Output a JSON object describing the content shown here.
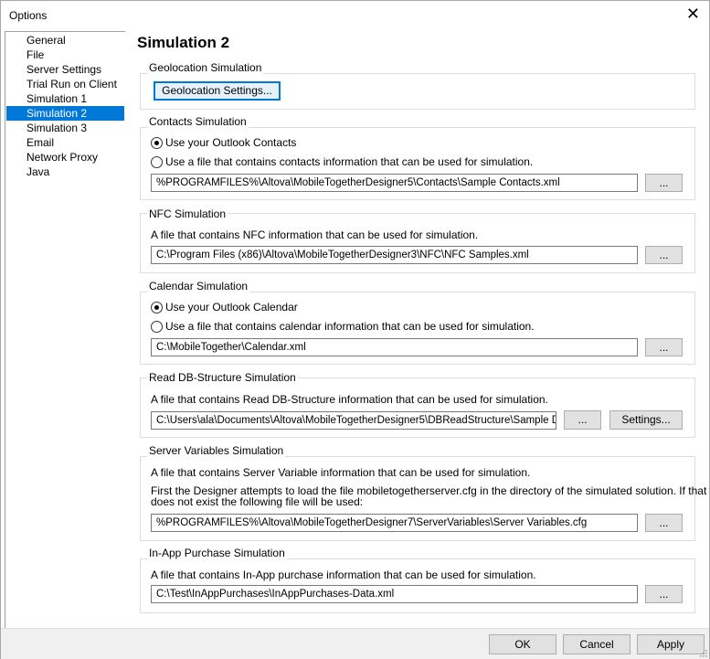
{
  "window": {
    "title": "Options"
  },
  "nav": {
    "items": [
      {
        "label": "General"
      },
      {
        "label": "File"
      },
      {
        "label": "Server Settings"
      },
      {
        "label": "Trial Run on Client"
      },
      {
        "label": "Simulation 1"
      },
      {
        "label": "Simulation 2"
      },
      {
        "label": "Simulation 3"
      },
      {
        "label": "Email"
      },
      {
        "label": "Network Proxy"
      },
      {
        "label": "Java"
      }
    ],
    "selected": "Simulation 2"
  },
  "page": {
    "title": "Simulation 2"
  },
  "geolocation": {
    "label": "Geolocation Simulation",
    "button": "Geolocation Settings..."
  },
  "contacts": {
    "label": "Contacts Simulation",
    "option_outlook": "Use your Outlook Contacts",
    "option_file": "Use a file that contains contacts information that can be used for simulation.",
    "path": "%PROGRAMFILES%\\Altova\\MobileTogetherDesigner5\\Contacts\\Sample Contacts.xml",
    "browse": "..."
  },
  "nfc": {
    "label": "NFC Simulation",
    "description": "A file that contains NFC information that can be used for simulation.",
    "path": "C:\\Program Files (x86)\\Altova\\MobileTogetherDesigner3\\NFC\\NFC Samples.xml",
    "browse": "..."
  },
  "calendar": {
    "label": "Calendar Simulation",
    "option_outlook": "Use your Outlook Calendar",
    "option_file": "Use a file that contains calendar information that can be used for simulation.",
    "path": "C:\\MobileTogether\\Calendar.xml",
    "browse": "..."
  },
  "dbstructure": {
    "label": "Read DB-Structure Simulation",
    "description": "A file that contains Read DB-Structure information that can be used for simulation.",
    "path": "C:\\Users\\ala\\Documents\\Altova\\MobileTogetherDesigner5\\DBReadStructure\\Sample DB Read Structure.xml",
    "browse": "...",
    "settings": "Settings..."
  },
  "servervars": {
    "label": "Server Variables Simulation",
    "description": "A file that contains Server Variable information that can be used for simulation.",
    "note_line1": "First the Designer attempts to load the file mobiletogetherserver.cfg in the directory of the simulated solution. If that file",
    "note_line2": "does not exist the following file will be used:",
    "path": "%PROGRAMFILES%\\Altova\\MobileTogetherDesigner7\\ServerVariables\\Server Variables.cfg",
    "browse": "..."
  },
  "inapp": {
    "label": "In-App Purchase Simulation",
    "description": "A file that contains In-App purchase information that can be used for simulation.",
    "path": "C:\\Test\\InAppPurchases\\InAppPurchases-Data.xml",
    "browse": "..."
  },
  "footer": {
    "ok": "OK",
    "cancel": "Cancel",
    "apply": "Apply"
  },
  "colors": {
    "selection": "#0078d7",
    "button_face": "#e1e1e1",
    "footer_bg": "#f0f0f0"
  }
}
